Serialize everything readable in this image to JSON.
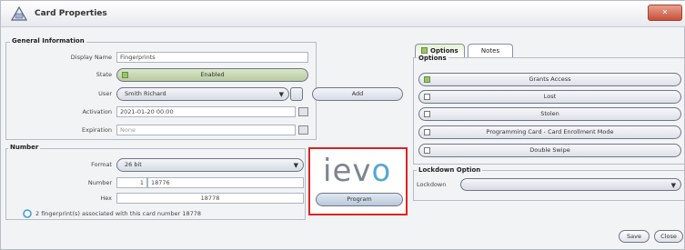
{
  "window": {
    "title": "Card Properties",
    "close_label": "✕"
  },
  "general": {
    "legend": "General Information",
    "display_name_label": "Display Name",
    "display_name_value": "Fingerprints",
    "state_label": "State",
    "state_value": "Enabled",
    "user_label": "User",
    "user_value": "Smith Richard",
    "add_label": "Add",
    "activation_label": "Activation",
    "activation_value": "2021-01-20 00:00",
    "expiration_label": "Expiration",
    "expiration_value": "None"
  },
  "number": {
    "legend": "Number",
    "format_label": "Format",
    "format_value": "26 bit",
    "number_label": "Number",
    "number_prefix": "1",
    "number_value": "18776",
    "hex_label": "Hex",
    "hex_value": "18778",
    "info_text": "2 fingerprint(s) associated with this card number 18778"
  },
  "ievo": {
    "logo_i": "iev",
    "logo_o": "o",
    "program_label": "Program"
  },
  "tabs": [
    {
      "label": "Options"
    },
    {
      "label": "Notes"
    }
  ],
  "options": {
    "legend": "Options",
    "items": [
      {
        "label": "Grants Access",
        "checked": true
      },
      {
        "label": "Lost",
        "checked": false
      },
      {
        "label": "Stolen",
        "checked": false
      },
      {
        "label": "Programming Card - Card Enrollment Mode",
        "checked": false
      },
      {
        "label": "Double Swipe",
        "checked": false
      }
    ]
  },
  "lockdown": {
    "legend": "Lockdown Option",
    "label": "Lockdown",
    "value": ""
  },
  "footer": {
    "save_label": "Save",
    "close_label": "Close"
  }
}
